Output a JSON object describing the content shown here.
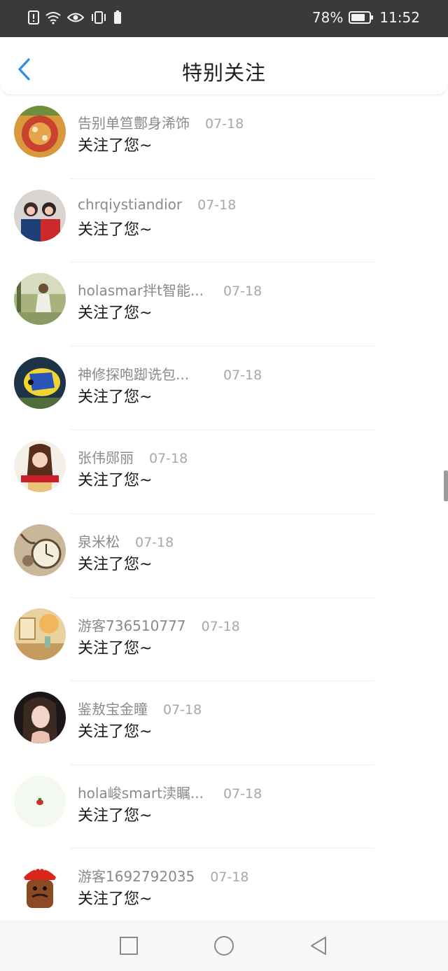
{
  "status_bar": {
    "battery_percent": "78%",
    "time": "11:52",
    "icons": [
      "alert-icon",
      "wifi-icon",
      "eye-icon",
      "vibrate-icon",
      "battery-small-icon",
      "battery-icon"
    ]
  },
  "header": {
    "title": "特别关注",
    "back_icon": "chevron-left-icon"
  },
  "colors": {
    "accent": "#2f8ee8",
    "status_bar_bg": "#3a3a3a"
  },
  "items": [
    {
      "name": "告别单笪鄷身浠饰",
      "date": "07-18",
      "action": "关注了您~"
    },
    {
      "name": "chrqiystiandior",
      "date": "07-18",
      "action": "关注了您~"
    },
    {
      "name": "holasmar拌t智能...",
      "date": "07-18",
      "action": "关注了您~"
    },
    {
      "name": "神修探咆踋诜包...",
      "date": "07-18",
      "action": "关注了您~"
    },
    {
      "name": "张伟郧丽",
      "date": "07-18",
      "action": "关注了您~"
    },
    {
      "name": "泉米松",
      "date": "07-18",
      "action": "关注了您~"
    },
    {
      "name": "游客736510777",
      "date": "07-18",
      "action": "关注了您~"
    },
    {
      "name": "鉴敖宝金瞳",
      "date": "07-18",
      "action": "关注了您~"
    },
    {
      "name": "hola峻smart渎瞩...",
      "date": "07-18",
      "action": "关注了您~"
    },
    {
      "name": "游客1692792035",
      "date": "07-18",
      "action": "关注了您~"
    }
  ],
  "bottom_nav": [
    "recents-square-icon",
    "home-circle-icon",
    "back-triangle-icon"
  ]
}
